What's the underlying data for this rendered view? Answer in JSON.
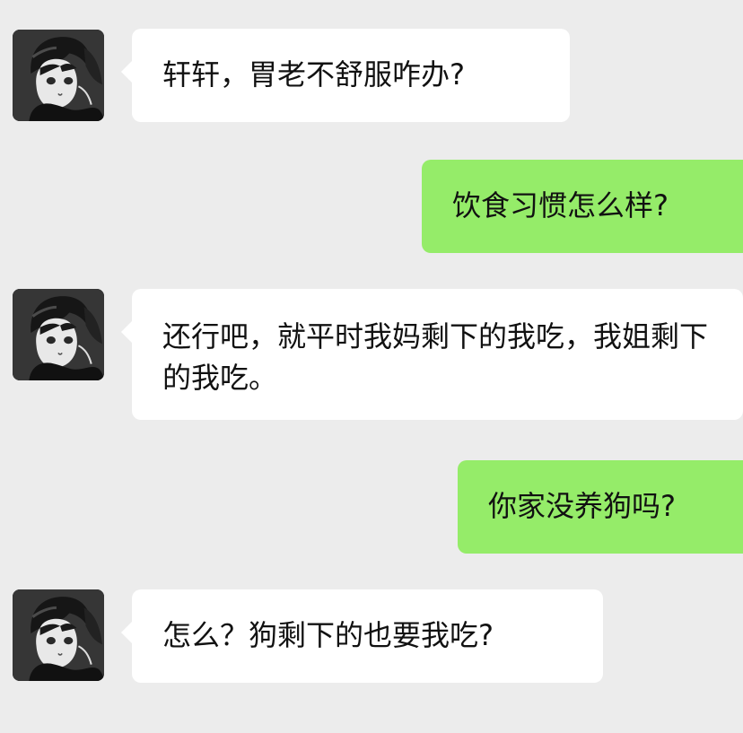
{
  "conversation": {
    "messages": [
      {
        "sender": "contact",
        "text": "轩轩，胃老不舒服咋办?"
      },
      {
        "sender": "me",
        "text": "饮食习惯怎么样?"
      },
      {
        "sender": "contact",
        "text": "还行吧，就平时我妈剩下的我吃，我姐剩下的我吃。"
      },
      {
        "sender": "me",
        "text": "你家没养狗吗?"
      },
      {
        "sender": "contact",
        "text": "怎么？狗剩下的也要我吃?"
      }
    ]
  },
  "colors": {
    "background": "#ececec",
    "incoming_bubble": "#ffffff",
    "outgoing_bubble": "#95ec69",
    "text": "#111111"
  },
  "icons": {
    "avatar": "anime-avatar-icon"
  }
}
